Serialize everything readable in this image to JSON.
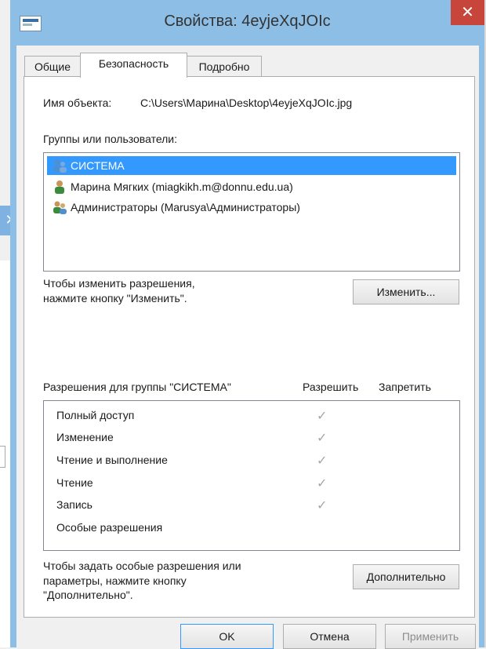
{
  "background_window": {
    "close_glyph": "✕"
  },
  "dialog": {
    "title": "Свойства: 4eyjeXqJOIc",
    "close_glyph": "✕",
    "tabs": [
      {
        "label": "Общие"
      },
      {
        "label": "Безопасность"
      },
      {
        "label": "Подробно"
      }
    ],
    "object_name_label": "Имя объекта:",
    "object_name_value": "C:\\Users\\Марина\\Desktop\\4eyjeXqJOIc.jpg",
    "groups_label": "Группы или пользователи:",
    "groups": [
      {
        "name": "СИСТЕМА",
        "icon": "group-users-icon"
      },
      {
        "name": "Марина Мягких (miagkikh.m@donnu.edu.ua)",
        "icon": "user-icon"
      },
      {
        "name": "Администраторы (Marusya\\Администраторы)",
        "icon": "group-users-icon"
      }
    ],
    "change_hint_line1": "Чтобы изменить разрешения,",
    "change_hint_line2": "нажмите кнопку \"Изменить\".",
    "change_button": "Изменить...",
    "permissions_label": "Разрешения для группы \"СИСТЕМА\"",
    "allow_header": "Разрешить",
    "deny_header": "Запретить",
    "permissions": [
      {
        "name": "Полный доступ",
        "allow": "✓"
      },
      {
        "name": "Изменение",
        "allow": "✓"
      },
      {
        "name": "Чтение и выполнение",
        "allow": "✓"
      },
      {
        "name": "Чтение",
        "allow": "✓"
      },
      {
        "name": "Запись",
        "allow": "✓"
      },
      {
        "name": "Особые разрешения",
        "allow": ""
      }
    ],
    "advanced_hint_line1": "Чтобы задать особые разрешения или",
    "advanced_hint_line2": "параметры, нажмите кнопку",
    "advanced_hint_line3": "\"Дополнительно\".",
    "advanced_button": "Дополнительно",
    "ok_button": "OK",
    "cancel_button": "Отмена",
    "apply_button": "Применить"
  },
  "colors": {
    "title_bar": "#8dbfe6",
    "close": "#c7453b",
    "selection": "#3399ff"
  }
}
